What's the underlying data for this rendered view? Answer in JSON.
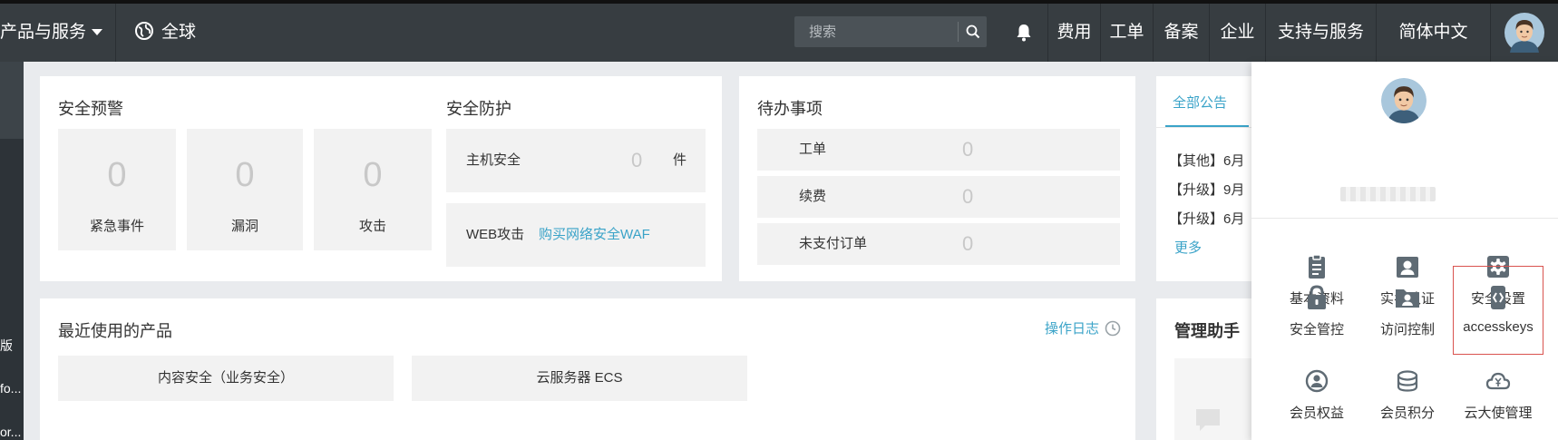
{
  "topbar": {
    "products_label": "产品与服务",
    "region_label": "全球",
    "search_placeholder": "搜索",
    "nav_items": [
      "费用",
      "工单",
      "备案",
      "企业",
      "支持与服务",
      "简体中文"
    ]
  },
  "sidebar": {
    "items": [
      "版",
      "fo...",
      "or..."
    ]
  },
  "security_alert": {
    "title": "安全预警",
    "tiles": [
      {
        "value": "0",
        "label": "紧急事件"
      },
      {
        "value": "0",
        "label": "漏洞"
      },
      {
        "value": "0",
        "label": "攻击"
      }
    ]
  },
  "security_protection": {
    "title": "安全防护",
    "host_label": "主机安全",
    "host_value": "0",
    "host_unit": "件",
    "web_label": "WEB攻击",
    "web_link": "购买网络安全WAF"
  },
  "todo": {
    "title": "待办事项",
    "rows": [
      {
        "label": "工单",
        "value": "0"
      },
      {
        "label": "续费",
        "value": "0"
      },
      {
        "label": "未支付订单",
        "value": "0"
      }
    ]
  },
  "announcements": {
    "tab": "全部公告",
    "items": [
      "【其他】6月",
      "【升级】9月",
      "【升级】6月"
    ],
    "more": "更多"
  },
  "recent_products": {
    "title": "最近使用的产品",
    "log_link": "操作日志",
    "products": [
      "内容安全（业务安全）",
      "云服务器 ECS"
    ]
  },
  "assistant": {
    "title": "管理助手"
  },
  "user_menu": {
    "items": [
      {
        "label": "基本资料",
        "icon": "clipboard-icon"
      },
      {
        "label": "实名认证",
        "icon": "id-card-icon"
      },
      {
        "label": "安全设置",
        "icon": "gear-icon"
      },
      {
        "label": "安全管控",
        "icon": "lock-icon"
      },
      {
        "label": "访问控制",
        "icon": "folder-user-icon"
      },
      {
        "label": "accesskeys",
        "icon": "code-icon"
      },
      {
        "label": "会员权益",
        "icon": "member-icon"
      },
      {
        "label": "会员积分",
        "icon": "coins-icon"
      },
      {
        "label": "云大使管理",
        "icon": "cloud-yen-icon"
      }
    ]
  },
  "colors": {
    "topbar_bg": "#373d41",
    "link": "#3aa3c8",
    "icon_gray": "#5f6b74",
    "highlight": "#d9534f"
  }
}
